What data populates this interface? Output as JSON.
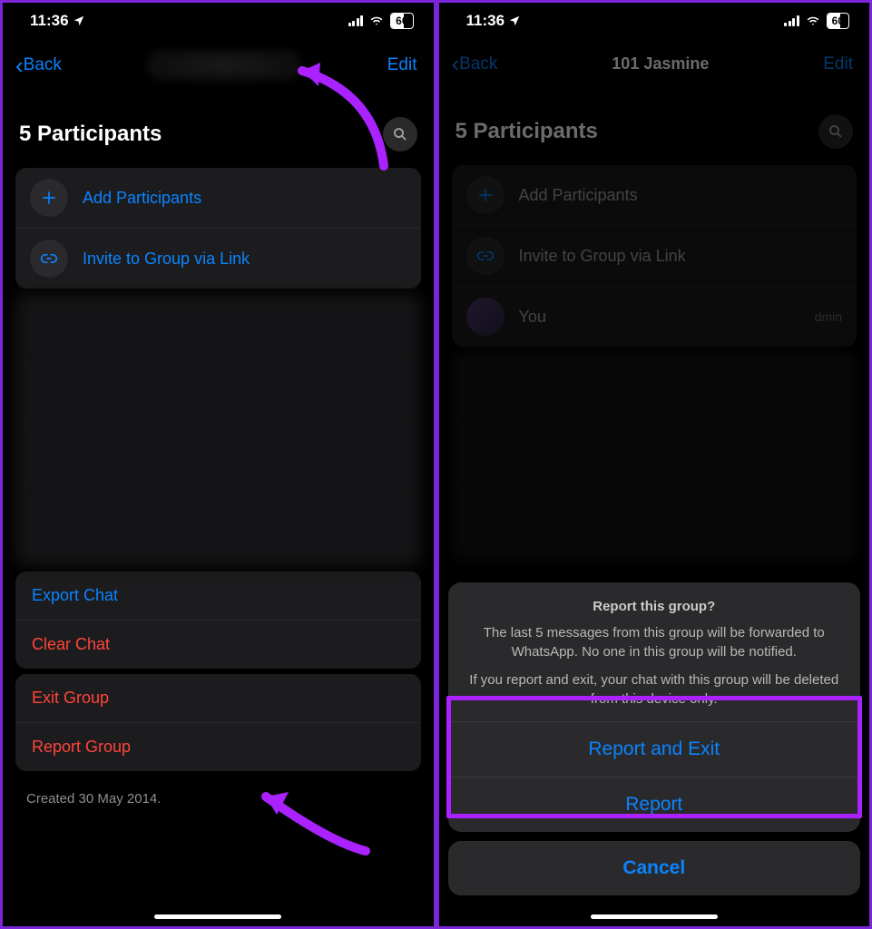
{
  "status": {
    "time": "11:36",
    "battery": "60"
  },
  "left": {
    "nav": {
      "back": "Back",
      "edit": "Edit"
    },
    "header": "5 Participants",
    "addParticipants": "Add Participants",
    "inviteLink": "Invite to Group via Link",
    "exportChat": "Export Chat",
    "clearChat": "Clear Chat",
    "exitGroup": "Exit Group",
    "reportGroup": "Report Group",
    "created": "Created 30 May 2014."
  },
  "right": {
    "nav": {
      "back": "Back",
      "title": "101 Jasmine",
      "edit": "Edit"
    },
    "header": "5 Participants",
    "addParticipants": "Add Participants",
    "inviteLink": "Invite to Group via Link",
    "you": "You",
    "adminBadge": "dmin",
    "sheet": {
      "title": "Report this group?",
      "line1": "The last 5 messages from this group will be forwarded to WhatsApp. No one in this group will be notified.",
      "line2": "If you report and exit, your chat with this group will be deleted from this device only.",
      "reportAndExit": "Report and Exit",
      "report": "Report",
      "cancel": "Cancel"
    }
  }
}
